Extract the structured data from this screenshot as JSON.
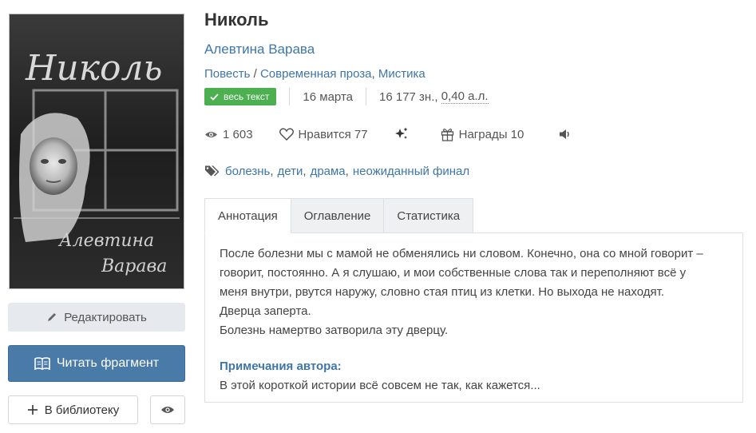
{
  "book": {
    "title": "Николь",
    "author": "Алевтина Варава",
    "genres": {
      "form": "Повесть",
      "separator": "/",
      "items": [
        "Современная проза",
        "Мистика"
      ]
    }
  },
  "cover": {
    "title_text": "Николь",
    "author_line1": "Алевтина",
    "author_line2": "Варава"
  },
  "meta": {
    "badge": "весь текст",
    "date": "16 марта",
    "size_chars": "16 177 зн.,",
    "size_sheets": "0,40 а.л."
  },
  "stats": {
    "views": "1 603",
    "likes_label": "Нравится",
    "likes_count": "77",
    "awards_label": "Награды",
    "awards_count": "10"
  },
  "tags": [
    "болезнь",
    "дети",
    "драма",
    "неожиданный финал"
  ],
  "tabs": [
    "Аннотация",
    "Оглавление",
    "Статистика"
  ],
  "annotation": {
    "line1": "После болезни мы с мамой не обменялись ни словом. Конечно, она со мной говорит –",
    "line2": "говорит, постоянно. А я слушаю, и мои собственные слова так и переполняют всё у",
    "line3": "меня внутри, рвутся наружу, словно стая птиц из клетки. Но выхода не находят.",
    "line4": "Дверца заперта.",
    "line5": "Болезнь намертво затворила эту дверцу.",
    "notes_title": "Примечания автора:",
    "notes_text": "В этой короткой истории всё совсем не так, как кажется..."
  },
  "buttons": {
    "edit": "Редактировать",
    "read": "Читать фрагмент",
    "library": "В библиотеку"
  },
  "colors": {
    "link": "#3e76a8",
    "badge": "#4caf50",
    "read_button": "#4a7aa7",
    "edit_button": "#e6e9ed"
  },
  "icons": [
    "check-icon",
    "eye-icon",
    "heart-icon",
    "sparkles-icon",
    "gift-icon",
    "speaker-icon",
    "tag-icon",
    "pencil-icon",
    "book-icon",
    "plus-icon"
  ]
}
